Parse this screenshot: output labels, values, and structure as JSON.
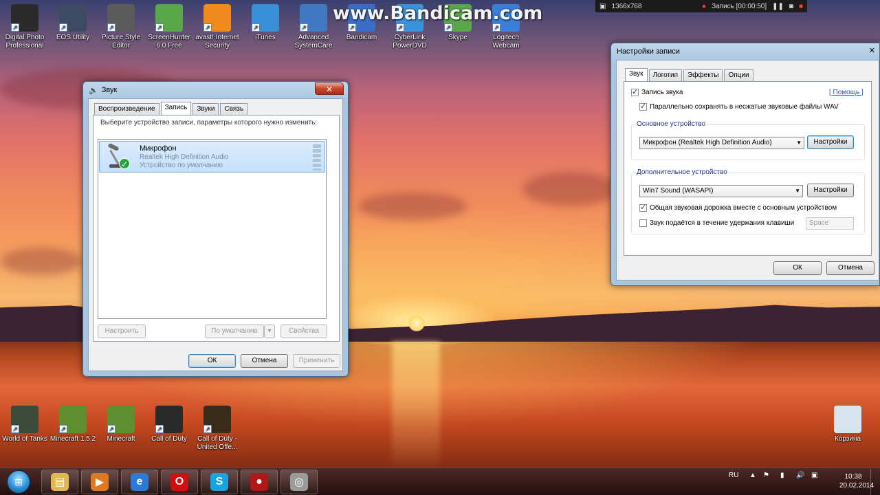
{
  "watermark": "www.Bandicam.com",
  "bandicam_bar": {
    "resolution": "1366x768",
    "record_label": "Запись [00:00:50]"
  },
  "desktop_icons": [
    {
      "label": "Digital Photo Professional",
      "color": "#2b2b2b"
    },
    {
      "label": "EOS Utility",
      "color": "#3c4a63"
    },
    {
      "label": "Picture Style Editor",
      "color": "#5b5b5b"
    },
    {
      "label": "ScreenHunter 6.0 Free",
      "color": "#5aa64b"
    },
    {
      "label": "avast! Internet Security",
      "color": "#f08a1c"
    },
    {
      "label": "iTunes",
      "color": "#3a8fd8"
    },
    {
      "label": "Advanced SystemCare",
      "color": "#4178c2"
    },
    {
      "label": "Bandicam",
      "color": "#3a6cc5"
    },
    {
      "label": "CyberLink PowerDVD",
      "color": "#3a93d8"
    },
    {
      "label": "Skype",
      "color": "#5aa64b"
    },
    {
      "label": "Logitech Webcam",
      "color": "#3a7ed8"
    },
    {
      "label": "World of Tanks",
      "color": "#3c4a3a"
    },
    {
      "label": "Minecraft 1.5.2",
      "color": "#5f8f2e"
    },
    {
      "label": "Minecraft",
      "color": "#5f8f2e"
    },
    {
      "label": "Call of Duty",
      "color": "#2a2a2a"
    },
    {
      "label": "Call of Duty - United Offe...",
      "color": "#3a2a1a"
    },
    {
      "label": "Корзина",
      "color": "#d8e4ee"
    }
  ],
  "sound_dialog": {
    "title": "Звук",
    "tabs": [
      "Воспроизведение",
      "Запись",
      "Звуки",
      "Связь"
    ],
    "instruction": "Выберите устройство записи, параметры которого нужно изменить:",
    "device": {
      "name": "Микрофон",
      "driver": "Realtek High Definition Audio",
      "status": "Устройство по умолчанию"
    },
    "configure_button": "Настроить",
    "default_button": "По умолчанию",
    "properties_button": "Свойства",
    "ok_button": "ОК",
    "cancel_button": "Отмена",
    "apply_button": "Применить"
  },
  "record_settings": {
    "title": "Настройки записи",
    "tabs": [
      "Звук",
      "Логотип",
      "Эффекты",
      "Опции"
    ],
    "record_sound": "Запись звука",
    "help_link": "[ Помощь ]",
    "save_wav": "Параллельно сохранять в несжатые звуковые файлы WAV",
    "primary_group": "Основное устройство",
    "primary_device": "Микрофон (Realtek High Definition Audio)",
    "settings_button": "Настройки",
    "secondary_group": "Дополнительное устройство",
    "secondary_device": "Win7 Sound (WASAPI)",
    "mix_track": "Общая звуковая дорожка вместе с основным устройством",
    "push_to_talk": "Звук подаётся в течение удержания клавиши",
    "key_placeholder": "Space",
    "ok_button": "ОК",
    "cancel_button": "Отмена"
  },
  "taskbar": {
    "apps": [
      {
        "name": "explorer",
        "color": "#e2b84a"
      },
      {
        "name": "media-player",
        "color": "#e0781e"
      },
      {
        "name": "internet-explorer",
        "color": "#2a7ad6"
      },
      {
        "name": "opera",
        "color": "#d01010"
      },
      {
        "name": "skype",
        "color": "#19a3e0"
      },
      {
        "name": "bandicam",
        "color": "#b01818"
      },
      {
        "name": "sound-control",
        "color": "#9a9a9a"
      }
    ],
    "language": "RU",
    "time": "10:38",
    "date": "20.02.2014"
  }
}
